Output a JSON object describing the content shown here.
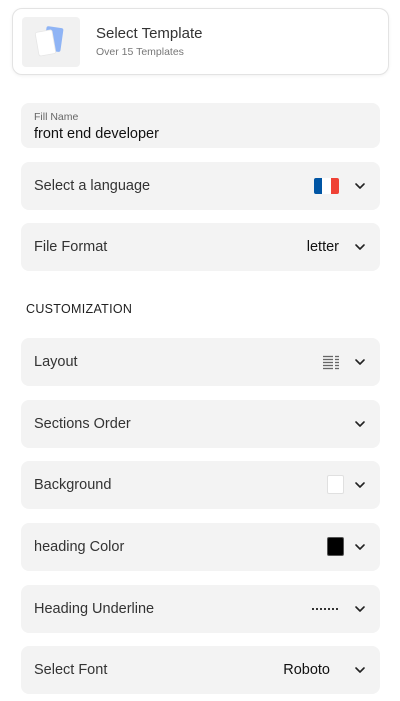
{
  "template": {
    "title": "Select Template",
    "subtitle": "Over 15 Templates"
  },
  "fill_name": {
    "label": "Fill Name",
    "value": "front end developer"
  },
  "language": {
    "label": "Select a language",
    "flag_colors": [
      "#0055A4",
      "#FFFFFF",
      "#EF4135"
    ]
  },
  "file_format": {
    "label": "File Format",
    "value": "letter"
  },
  "customization": {
    "heading": "CUSTOMIZATION",
    "layout": {
      "label": "Layout",
      "icon": "layout-lines-icon"
    },
    "sections_order": {
      "label": "Sections Order"
    },
    "background": {
      "label": "Background",
      "color": "#FFFFFF"
    },
    "heading_color": {
      "label": "heading Color",
      "color": "#000000"
    },
    "heading_underline": {
      "label": "Heading Underline",
      "icon": "dotted-line-icon"
    },
    "font": {
      "label": "Select Font",
      "value": "Roboto"
    }
  },
  "colors": {
    "row_bg": "#F3F3F3",
    "card_border": "#E3E3E3",
    "accent_blue": "#5B8DEF"
  }
}
